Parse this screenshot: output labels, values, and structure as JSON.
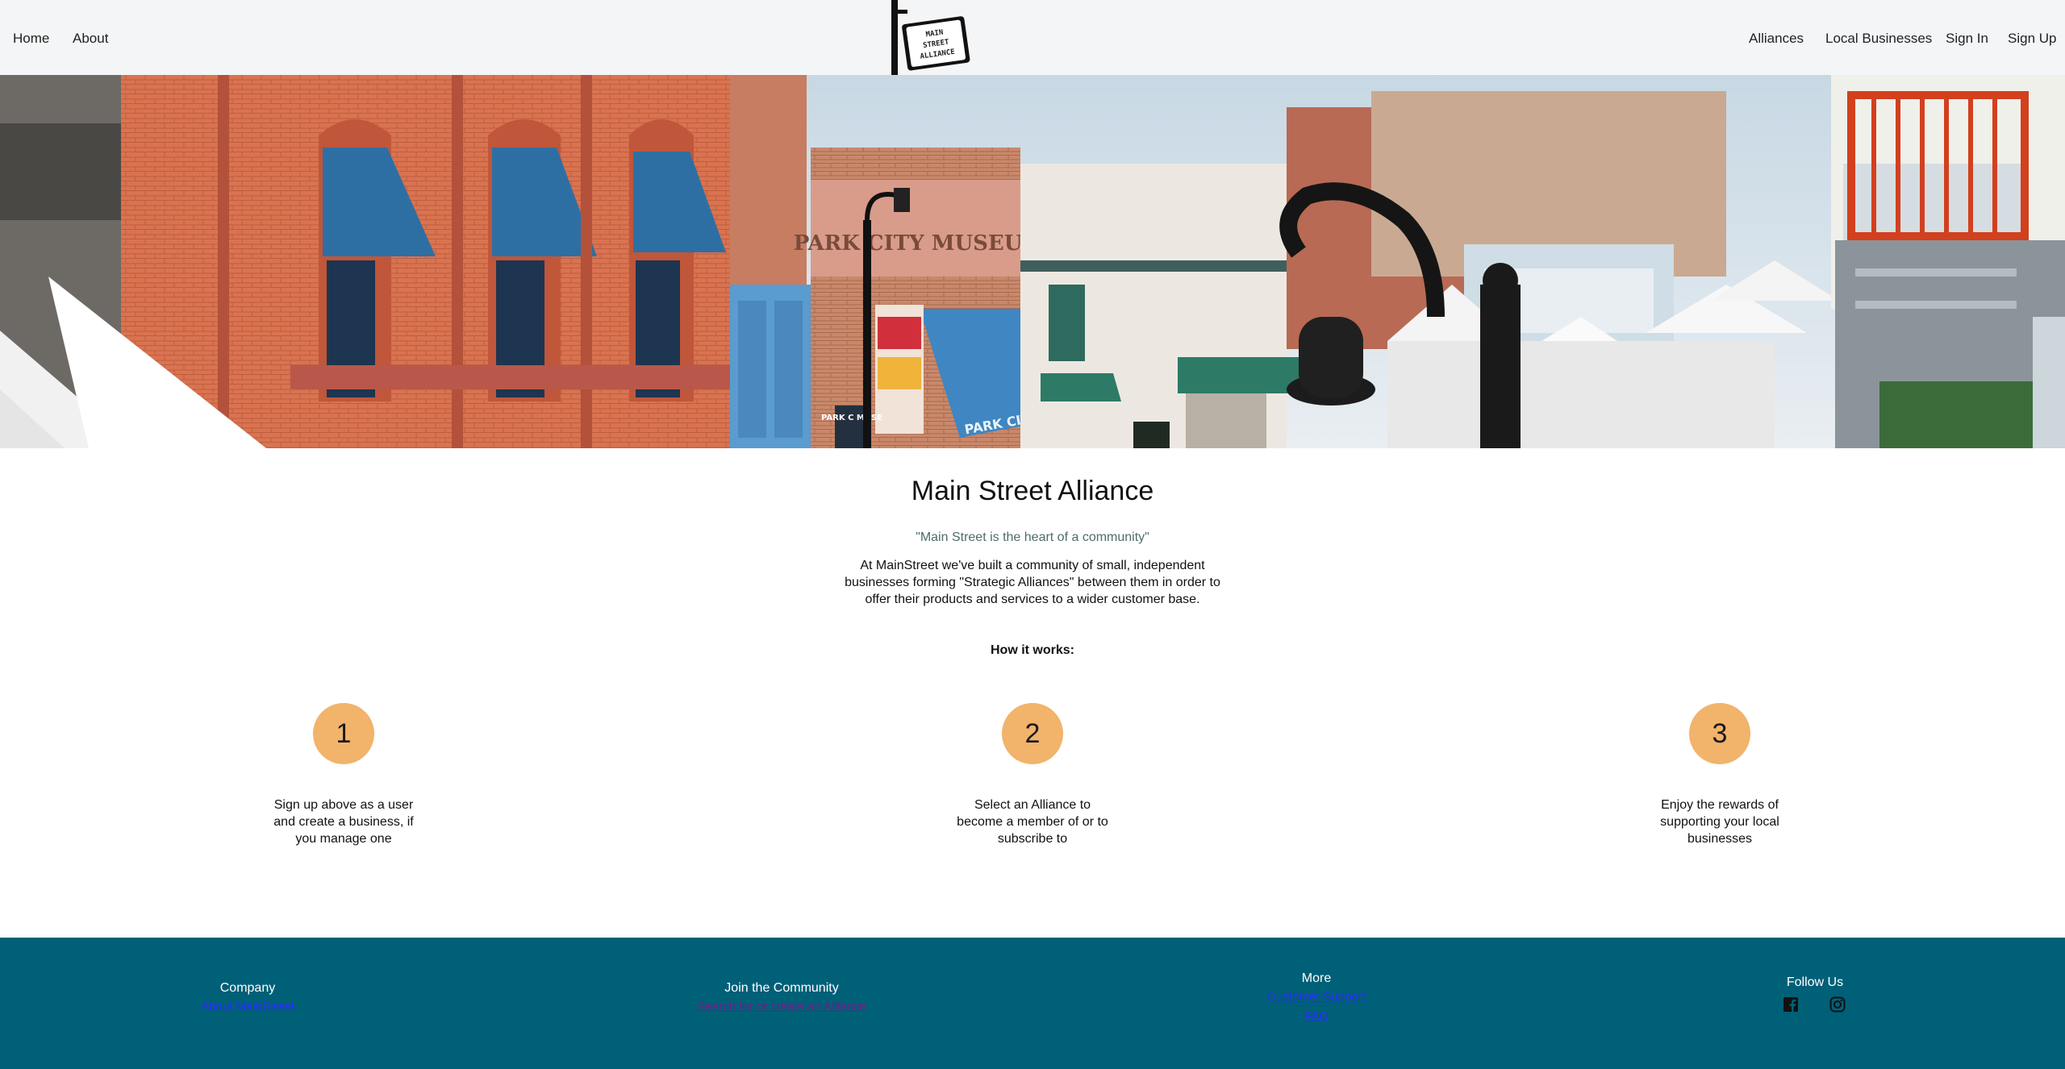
{
  "nav": {
    "home": "Home",
    "about": "About",
    "alliances": "Alliances",
    "local_businesses": "Local Businesses",
    "sign_in": "Sign In",
    "sign_up": "Sign Up"
  },
  "logo": {
    "line1": "MAIN",
    "line2": "STREET",
    "line3": "ALLIANCE"
  },
  "hero": {
    "sign_museum": "PARK CITY MUSEUM",
    "awning_text": "PARK CITY MUSEUM",
    "small_sign": "PARK C MUSE"
  },
  "main": {
    "title": "Main Street Alliance",
    "quote": "\"Main Street is the heart of a community\"",
    "intro": "At MainStreet we've built a community of small, independent businesses forming \"Strategic Alliances\" between them in order to offer their products and services to a wider customer base.",
    "how_title": "How it works:"
  },
  "steps": [
    {
      "number": "1",
      "text": "Sign up above as a user and create a business, if you manage one"
    },
    {
      "number": "2",
      "text": "Select an Alliance to become a member of or to subscribe to"
    },
    {
      "number": "3",
      "text": "Enjoy the rewards of supporting your local businesses"
    }
  ],
  "footer": {
    "company": {
      "heading": "Company",
      "link": "About MainStreet"
    },
    "community": {
      "heading": "Join the Community",
      "link": "Search for or create an Alliance"
    },
    "more": {
      "heading": "More",
      "links": [
        "Customer Support",
        "FAQ"
      ]
    },
    "follow": {
      "heading": "Follow Us",
      "icons": [
        "facebook-icon",
        "instagram-icon"
      ]
    }
  },
  "colors": {
    "nav_bg": "#f4f5f7",
    "step_circle": "#f2b36b",
    "footer_bg": "#006078",
    "link": "#2a2aff",
    "quote": "#4f6b6d"
  }
}
